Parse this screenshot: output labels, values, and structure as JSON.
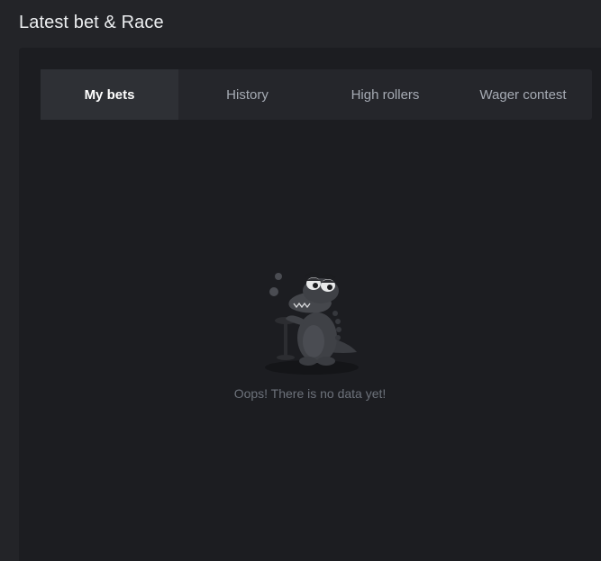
{
  "section": {
    "title": "Latest bet & Race"
  },
  "tabs": [
    {
      "label": "My bets",
      "active": true
    },
    {
      "label": "History",
      "active": false
    },
    {
      "label": "High rollers",
      "active": false
    },
    {
      "label": "Wager contest",
      "active": false
    }
  ],
  "empty_state": {
    "message": "Oops! There is no data yet!",
    "illustration": "crocodile-mascot"
  },
  "colors": {
    "background": "#232428",
    "panel": "#1c1d21",
    "tabs_bar": "#25262b",
    "active_tab": "#2e3035",
    "muted_text": "#6d727b"
  }
}
